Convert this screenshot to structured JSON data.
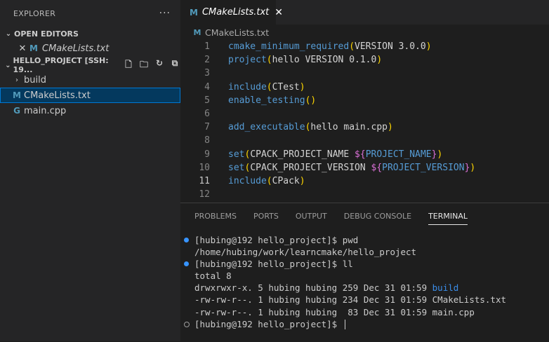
{
  "sidebar": {
    "title": "EXPLORER",
    "more": "···",
    "open_editors_label": "OPEN EDITORS",
    "open_editor_file": "CMakeLists.txt",
    "project_label": "HELLO_PROJECT [SSH: 19...",
    "tree": [
      {
        "label": "build",
        "type": "folder"
      },
      {
        "label": "CMakeLists.txt",
        "type": "cmake"
      },
      {
        "label": "main.cpp",
        "type": "cpp"
      }
    ]
  },
  "editor": {
    "tab_label": "CMakeLists.txt",
    "breadcrumb": "CMakeLists.txt",
    "line_numbers": [
      "1",
      "2",
      "3",
      "4",
      "5",
      "6",
      "7",
      "8",
      "9",
      "10",
      "11",
      "12"
    ],
    "current_line": "11"
  },
  "panel": {
    "tabs": [
      "PROBLEMS",
      "PORTS",
      "OUTPUT",
      "DEBUG CONSOLE",
      "TERMINAL"
    ],
    "active_tab": "TERMINAL",
    "terminal": [
      "[hubing@192 hello_project]$ pwd",
      "/home/hubing/work/learncmake/hello_project",
      "[hubing@192 hello_project]$ ll",
      "total 8",
      "drwxrwxr-x. 5 hubing hubing 259 Dec 31 01:59 ",
      "build",
      "-rw-rw-r--. 1 hubing hubing 234 Dec 31 01:59 CMakeLists.txt",
      "-rw-rw-r--. 1 hubing hubing  83 Dec 31 01:59 main.cpp",
      "[hubing@192 hello_project]$ "
    ]
  },
  "code": {
    "l1_fn": "cmake_minimum_required",
    "l1_args": "VERSION 3.0.0",
    "l2_fn": "project",
    "l2_args": "hello VERSION 0.1.0",
    "l4_fn": "include",
    "l4_args": "CTest",
    "l5_fn": "enable_testing",
    "l7_fn": "add_executable",
    "l7_args": "hello main.cpp",
    "l9_fn": "set",
    "l9_arg": "CPACK_PROJECT_NAME ",
    "l9_var": "PROJECT_NAME",
    "l10_fn": "set",
    "l10_arg": "CPACK_PROJECT_VERSION ",
    "l10_var": "PROJECT_VERSION",
    "l11_fn": "include",
    "l11_args": "CPack"
  },
  "colors": {
    "accent": "#0078d4",
    "keyword": "#569cd6",
    "bracket": "#ffd700",
    "dollar": "#da70d6"
  }
}
